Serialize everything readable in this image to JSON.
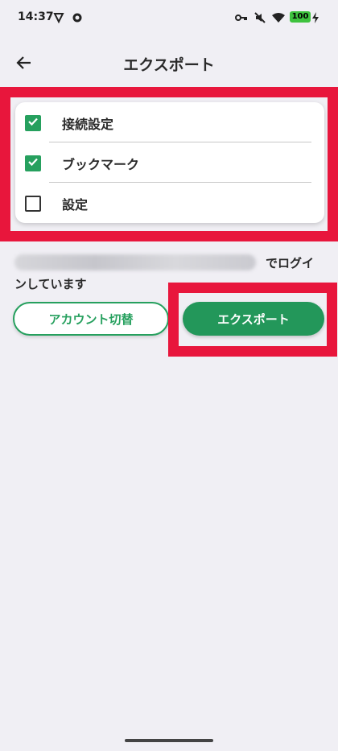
{
  "status_bar": {
    "time": "14:37",
    "battery": "100"
  },
  "header": {
    "title": "エクスポート"
  },
  "options": [
    {
      "label": "接続設定",
      "checked": true
    },
    {
      "label": "ブックマーク",
      "checked": true
    },
    {
      "label": "設定",
      "checked": false
    }
  ],
  "login": {
    "suffix": "でログイ",
    "line2": "ンしています"
  },
  "buttons": {
    "switch_account": "アカウント切替",
    "export": "エクスポート"
  },
  "colors": {
    "accent": "#26a05e",
    "highlight": "#e8163c",
    "background": "#f0eff4"
  }
}
